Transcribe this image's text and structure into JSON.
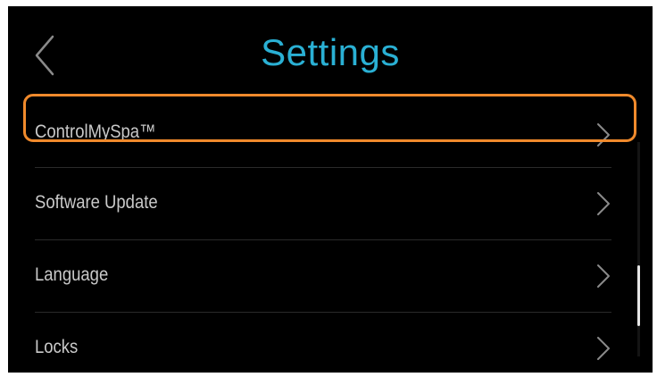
{
  "header": {
    "title": "Settings",
    "back_icon": "chevron-left-icon"
  },
  "menu": {
    "items": [
      {
        "label": "ControlMySpa™",
        "icon": "chevron-right-icon",
        "highlighted": true
      },
      {
        "label": "Software Update",
        "icon": "chevron-right-icon"
      },
      {
        "label": "Language",
        "icon": "chevron-right-icon"
      },
      {
        "label": "Locks",
        "icon": "chevron-right-icon"
      }
    ]
  },
  "colors": {
    "background": "#000000",
    "title": "#2ab0d4",
    "item_text": "#c9c9c9",
    "highlight": "#f08a2c"
  }
}
